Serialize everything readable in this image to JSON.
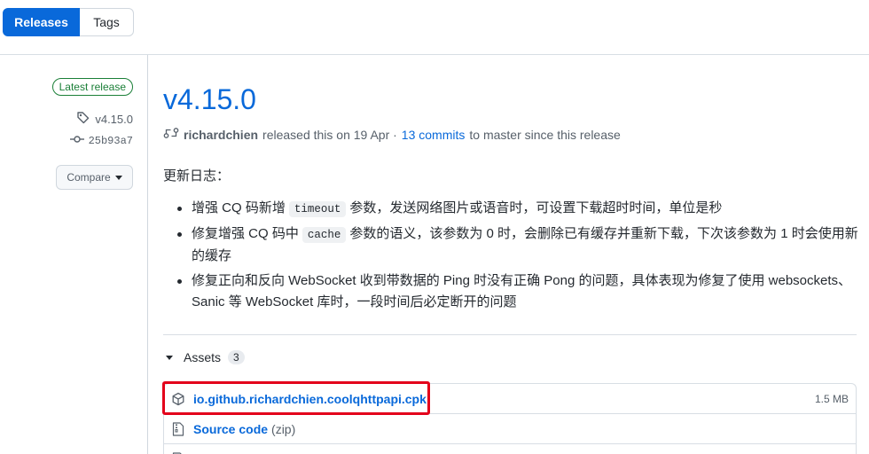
{
  "tabs": {
    "releases": "Releases",
    "tags": "Tags"
  },
  "meta": {
    "badge": "Latest release",
    "tag": "v4.15.0",
    "commit": "25b93a7",
    "compare": "Compare"
  },
  "release": {
    "title": "v4.15.0",
    "author": "richardchien",
    "released_text": "released this on 19 Apr ·",
    "commits_link": "13 commits",
    "since_text": "to master since this release"
  },
  "notes": {
    "heading": "更新日志：",
    "item1_a": "增强 CQ 码新增",
    "item1_code": "timeout",
    "item1_b": "参数，发送网络图片或语音时，可设置下载超时时间，单位是秒",
    "item2_a": "修复增强 CQ 码中",
    "item2_code": "cache",
    "item2_b": "参数的语义，该参数为 0 时，会删除已有缓存并重新下载，下次该参数为 1 时会使用新的缓存",
    "item3": "修复正向和反向 WebSocket 收到带数据的 Ping 时没有正确 Pong 的问题，具体表现为修复了使用 websockets、Sanic 等 WebSocket 库时，一段时间后必定断开的问题"
  },
  "assets": {
    "label": "Assets",
    "count": "3",
    "items": [
      {
        "name": "io.github.richardchien.coolqhttpapi.cpk",
        "size": "1.5 MB"
      },
      {
        "name": "Source code",
        "sub": "(zip)"
      },
      {
        "name": ""
      }
    ]
  },
  "colors": {
    "accent": "#0969da",
    "highlight": "#e3001b",
    "success": "#1a7f37"
  },
  "icons": [
    "tag-icon",
    "commit-icon",
    "git-compare-icon",
    "package-icon",
    "file-zip-icon"
  ]
}
